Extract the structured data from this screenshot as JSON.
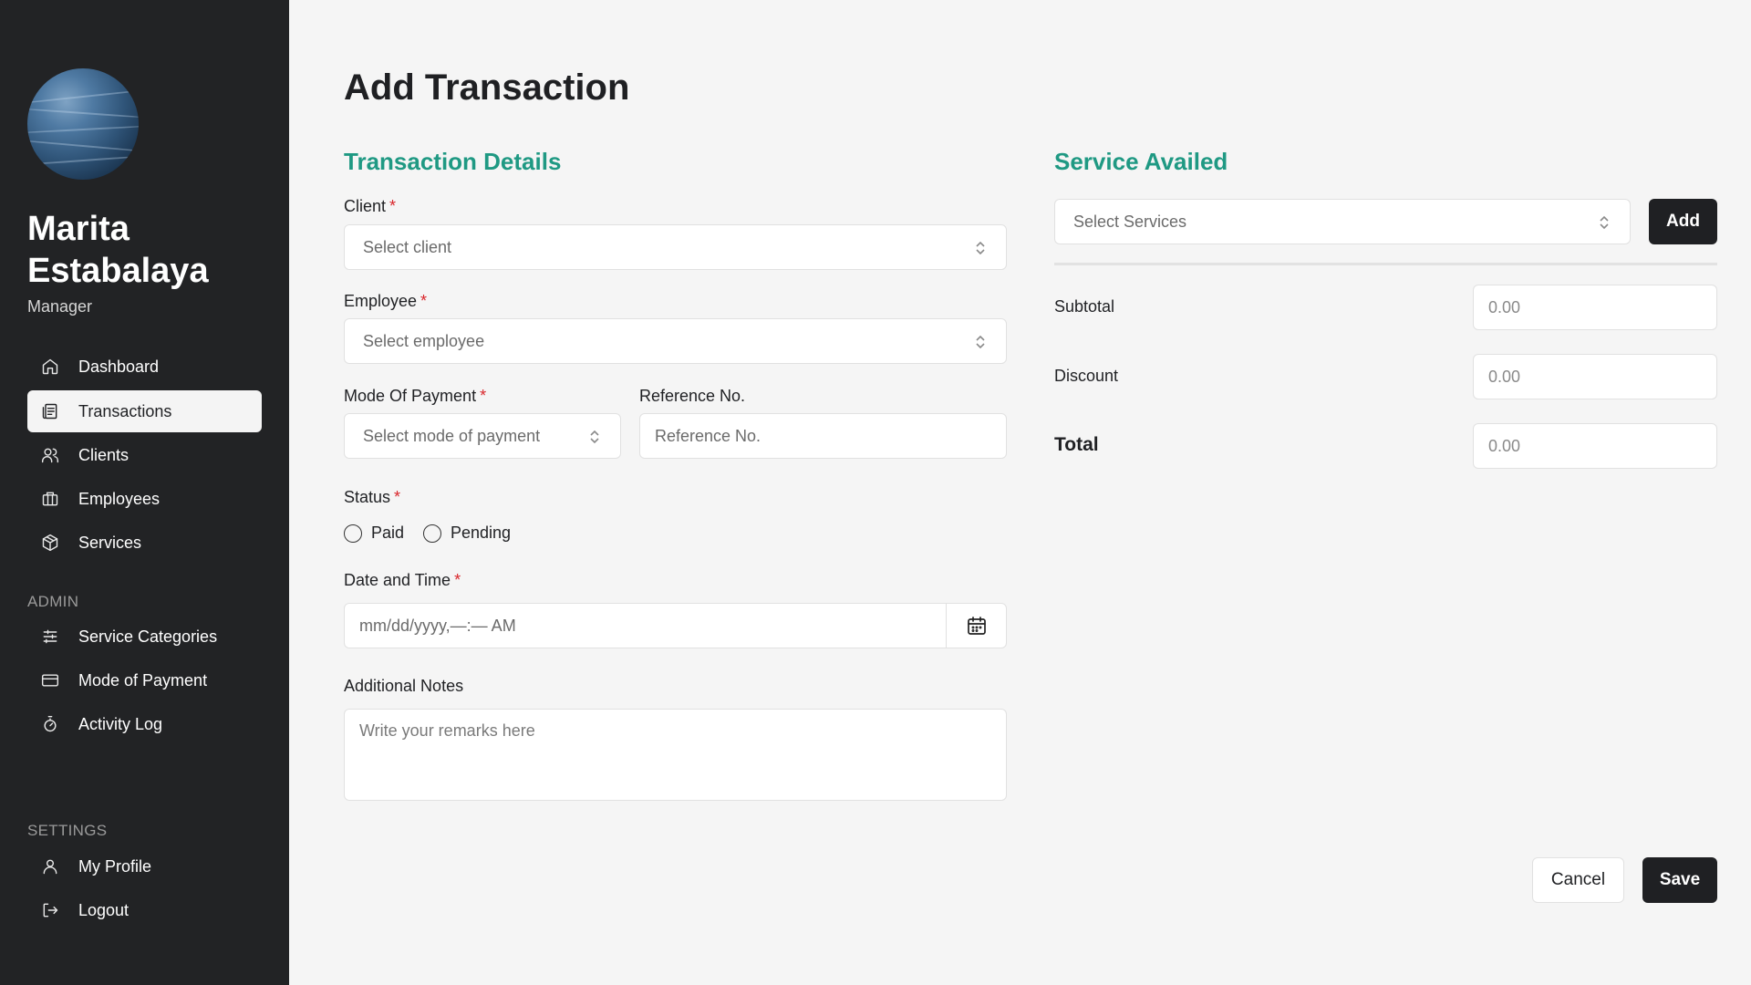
{
  "user": {
    "name": "Marita Estabalaya",
    "role": "Manager"
  },
  "nav": {
    "main": [
      {
        "label": "Dashboard",
        "icon": "home-icon"
      },
      {
        "label": "Transactions",
        "icon": "receipt-icon",
        "active": true
      },
      {
        "label": "Clients",
        "icon": "users-icon"
      },
      {
        "label": "Employees",
        "icon": "briefcase-icon"
      },
      {
        "label": "Services",
        "icon": "package-icon"
      }
    ],
    "admin_label": "ADMIN",
    "admin": [
      {
        "label": "Service Categories",
        "icon": "sliders-icon"
      },
      {
        "label": "Mode of Payment",
        "icon": "credit-card-icon"
      },
      {
        "label": "Activity Log",
        "icon": "timer-icon"
      }
    ],
    "settings_label": "SETTINGS",
    "settings": [
      {
        "label": "My Profile",
        "icon": "user-icon"
      },
      {
        "label": "Logout",
        "icon": "logout-icon"
      }
    ]
  },
  "page": {
    "title": "Add Transaction"
  },
  "details": {
    "title": "Transaction Details",
    "client_label": "Client",
    "client_placeholder": "Select client",
    "employee_label": "Employee",
    "employee_placeholder": "Select employee",
    "payment_label": "Mode Of Payment",
    "payment_placeholder": "Select mode of payment",
    "reference_label": "Reference No.",
    "reference_placeholder": "Reference No.",
    "status_label": "Status",
    "status_options": [
      "Paid",
      "Pending"
    ],
    "datetime_label": "Date and Time",
    "datetime_placeholder": "mm/dd/yyyy,—:— AM",
    "notes_label": "Additional Notes",
    "notes_placeholder": "Write your remarks here",
    "required_mark": "*"
  },
  "services": {
    "title": "Service Availed",
    "select_placeholder": "Select Services",
    "add_label": "Add",
    "subtotal_label": "Subtotal",
    "subtotal_value": "0.00",
    "discount_label": "Discount",
    "discount_value": "0.00",
    "total_label": "Total",
    "total_value": "0.00"
  },
  "actions": {
    "cancel_label": "Cancel",
    "save_label": "Save"
  },
  "colors": {
    "sidebar": "#222325",
    "accent": "#1f9983",
    "required": "#d9262b",
    "button_dark": "#1f2023"
  }
}
